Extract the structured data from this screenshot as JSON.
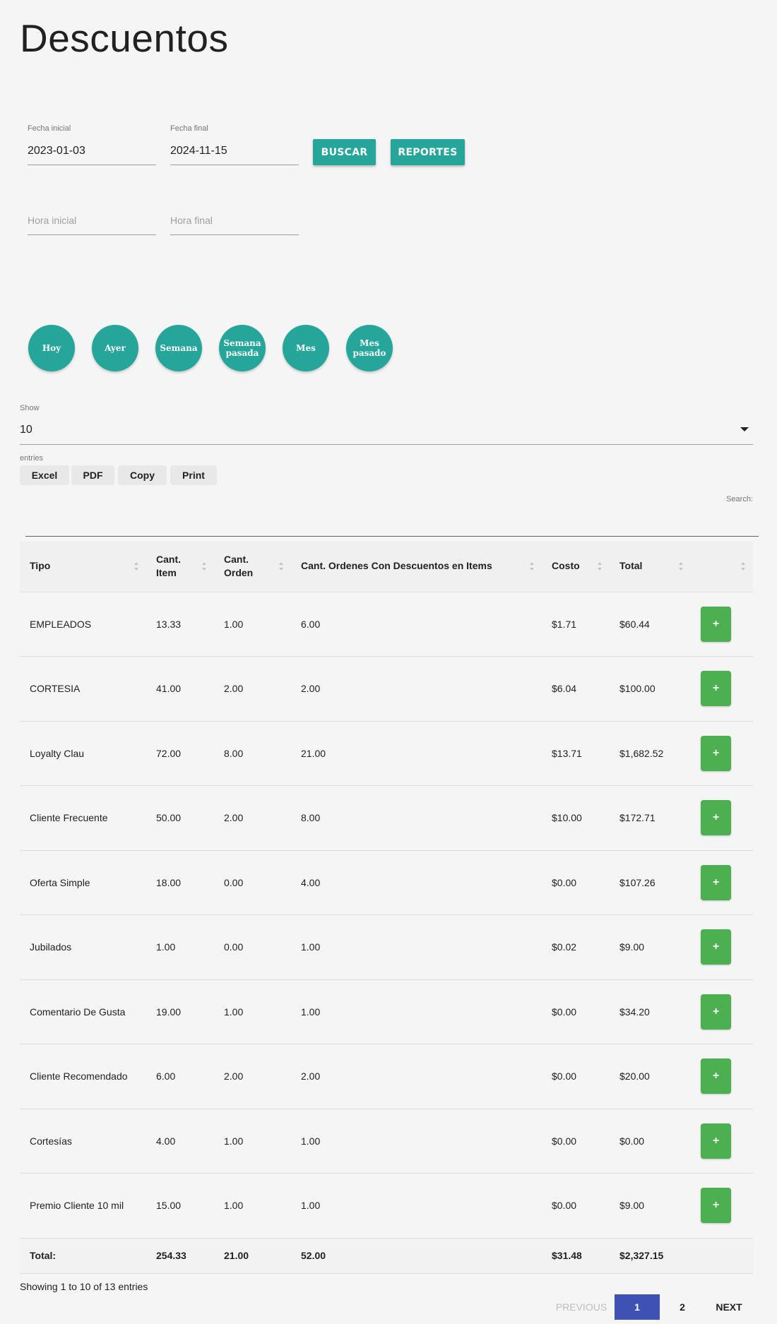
{
  "page": {
    "title": "Descuentos"
  },
  "filters": {
    "start_date_label": "Fecha inicial",
    "start_date_value": "2023-01-03",
    "end_date_label": "Fecha final",
    "end_date_value": "2024-11-15",
    "start_time_placeholder": "Hora inicial",
    "end_time_placeholder": "Hora final",
    "search_button": "BUSCAR",
    "reports_button": "REPORTES"
  },
  "quick_ranges": [
    "Hoy",
    "Ayer",
    "Semana",
    "Semana pasada",
    "Mes",
    "Mes pasado"
  ],
  "length": {
    "show_label": "Show",
    "value": "10",
    "entries_label": "entries"
  },
  "export_buttons": [
    "Excel",
    "PDF",
    "Copy",
    "Print"
  ],
  "search": {
    "label": "Search:"
  },
  "table": {
    "headers": [
      "Tipo",
      "Cant. Item",
      "Cant. Orden",
      "Cant. Ordenes Con Descuentos en Items",
      "Costo",
      "Total",
      ""
    ],
    "rows": [
      [
        "EMPLEADOS",
        "13.33",
        "1.00",
        "6.00",
        "$1.71",
        "$60.44"
      ],
      [
        "CORTESIA",
        "41.00",
        "2.00",
        "2.00",
        "$6.04",
        "$100.00"
      ],
      [
        "Loyalty Clau",
        "72.00",
        "8.00",
        "21.00",
        "$13.71",
        "$1,682.52"
      ],
      [
        "Cliente Frecuente",
        "50.00",
        "2.00",
        "8.00",
        "$10.00",
        "$172.71"
      ],
      [
        "Oferta Simple",
        "18.00",
        "0.00",
        "4.00",
        "$0.00",
        "$107.26"
      ],
      [
        "Jubilados",
        "1.00",
        "0.00",
        "1.00",
        "$0.02",
        "$9.00"
      ],
      [
        "Comentario De Gusta",
        "19.00",
        "1.00",
        "1.00",
        "$0.00",
        "$34.20"
      ],
      [
        "Cliente Recomendado",
        "6.00",
        "2.00",
        "2.00",
        "$0.00",
        "$20.00"
      ],
      [
        "Cortesías",
        "4.00",
        "1.00",
        "1.00",
        "$0.00",
        "$0.00"
      ],
      [
        "Premio Cliente 10 mil",
        "15.00",
        "1.00",
        "1.00",
        "$0.00",
        "$9.00"
      ]
    ],
    "row_action_label": "+",
    "footer": [
      "Total:",
      "254.33",
      "21.00",
      "52.00",
      "$31.48",
      "$2,327.15"
    ]
  },
  "info": {
    "text": "Showing 1 to 10 of 13 entries"
  },
  "pagination": {
    "previous": "PREVIOUS",
    "pages": [
      "1",
      "2"
    ],
    "next": "NEXT",
    "current": "1"
  },
  "colors": {
    "teal": "#26a69a",
    "green": "#4caf50",
    "indigo": "#3f51b5"
  }
}
